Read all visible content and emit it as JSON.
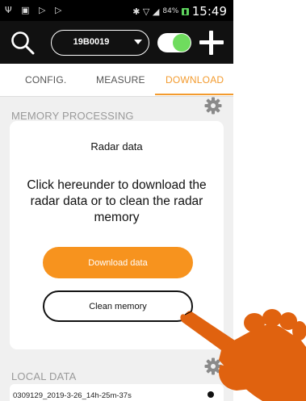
{
  "statusbar": {
    "left_icons": "Ψ ▣ ▷ ▷",
    "signal": "✱ ▽ ◢",
    "battery_pct": "84%",
    "battery_icon": "▮",
    "time": "15:49"
  },
  "appbar": {
    "device_selected": "19B0019",
    "accent": "#f39b2f",
    "toggle_color": "#6fdc5e"
  },
  "tabs": [
    {
      "label": "CONFIG."
    },
    {
      "label": "MEASURE"
    },
    {
      "label": "DOWNLOAD"
    }
  ],
  "memory": {
    "title": "MEMORY PROCESSING",
    "card_title": "Radar data",
    "description": "Click hereunder to download the radar data or to clean the radar memory",
    "download_label": "Download data",
    "clean_label": "Clean memory"
  },
  "local": {
    "title": "LOCAL DATA",
    "files": [
      "0309129_2019-3-26_14h-25m-37s"
    ]
  }
}
